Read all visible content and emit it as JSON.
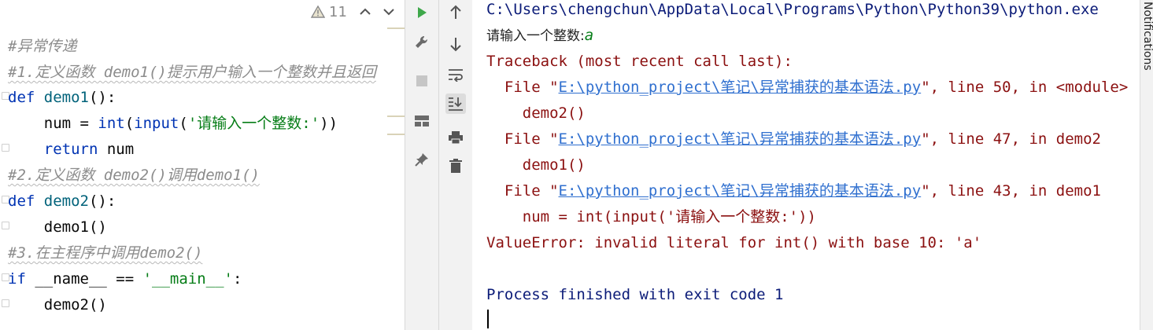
{
  "editor": {
    "warning_count": "11",
    "lines": [
      {
        "id": "c1",
        "parts": [
          {
            "t": "#异常传递",
            "c": "comment"
          }
        ]
      },
      {
        "id": "c2",
        "parts": [
          {
            "t": "#1.定义函数 demo1()提示用户输入一个整数并且返回",
            "c": "comment squig"
          }
        ]
      },
      {
        "id": "l3",
        "parts": [
          {
            "t": "def",
            "c": "kw"
          },
          {
            "t": " ",
            "c": ""
          },
          {
            "t": "demo1",
            "c": "fn"
          },
          {
            "t": "():",
            "c": ""
          }
        ]
      },
      {
        "id": "l4",
        "parts": [
          {
            "t": "    num = ",
            "c": ""
          },
          {
            "t": "int",
            "c": "kw"
          },
          {
            "t": "(",
            "c": ""
          },
          {
            "t": "input",
            "c": "kw"
          },
          {
            "t": "(",
            "c": ""
          },
          {
            "t": "'请输入一个整数:'",
            "c": "str"
          },
          {
            "t": "))",
            "c": ""
          }
        ]
      },
      {
        "id": "l5",
        "parts": [
          {
            "t": "    ",
            "c": ""
          },
          {
            "t": "return",
            "c": "kw"
          },
          {
            "t": " num",
            "c": ""
          }
        ]
      },
      {
        "id": "c6",
        "parts": [
          {
            "t": "#2.定义函数 demo2()调用demo1()",
            "c": "comment squig"
          }
        ]
      },
      {
        "id": "l7",
        "parts": [
          {
            "t": "def",
            "c": "kw"
          },
          {
            "t": " ",
            "c": ""
          },
          {
            "t": "demo2",
            "c": "fn"
          },
          {
            "t": "():",
            "c": ""
          }
        ]
      },
      {
        "id": "l8",
        "parts": [
          {
            "t": "    demo1()",
            "c": ""
          }
        ]
      },
      {
        "id": "c9",
        "parts": [
          {
            "t": "#3.在主程序中调用demo2()",
            "c": "comment squig"
          }
        ]
      },
      {
        "id": "l10",
        "parts": [
          {
            "t": "if",
            "c": "kw"
          },
          {
            "t": " __name__ == ",
            "c": ""
          },
          {
            "t": "'__main__'",
            "c": "str"
          },
          {
            "t": ":",
            "c": ""
          }
        ]
      },
      {
        "id": "l11",
        "parts": [
          {
            "t": "    demo2()",
            "c": ""
          }
        ]
      }
    ]
  },
  "run_toolbar": {
    "icons": [
      "run-icon",
      "wrench-icon",
      "stop-icon",
      "layout-icon",
      "pin-icon"
    ]
  },
  "console_toolbar": {
    "icons": [
      "up-arrow-icon",
      "down-arrow-icon",
      "soft-wrap-icon",
      "scroll-to-end-icon",
      "print-icon",
      "trash-icon"
    ]
  },
  "console": {
    "lines": [
      {
        "parts": [
          {
            "t": "C:\\Users\\chengchun\\AppData\\Local\\Programs\\Python\\Python39\\python.exe",
            "c": "navy"
          }
        ]
      },
      {
        "parts": [
          {
            "t": "请输入一个整数:",
            "c": "dark cjk"
          },
          {
            "t": "a",
            "c": "green-i"
          }
        ]
      },
      {
        "parts": [
          {
            "t": "Traceback (most recent call last):",
            "c": "red"
          }
        ]
      },
      {
        "parts": [
          {
            "t": "  File \"",
            "c": "red"
          },
          {
            "t": "E:\\python_project\\笔记\\异常捕获的基本语法.py",
            "c": "link"
          },
          {
            "t": "\", line 50, in <module>",
            "c": "red"
          }
        ]
      },
      {
        "parts": [
          {
            "t": "    demo2()",
            "c": "red"
          }
        ]
      },
      {
        "parts": [
          {
            "t": "  File \"",
            "c": "red"
          },
          {
            "t": "E:\\python_project\\笔记\\异常捕获的基本语法.py",
            "c": "link"
          },
          {
            "t": "\", line 47, in demo2",
            "c": "red"
          }
        ]
      },
      {
        "parts": [
          {
            "t": "    demo1()",
            "c": "red"
          }
        ]
      },
      {
        "parts": [
          {
            "t": "  File \"",
            "c": "red"
          },
          {
            "t": "E:\\python_project\\笔记\\异常捕获的基本语法.py",
            "c": "link"
          },
          {
            "t": "\", line 43, in demo1",
            "c": "red"
          }
        ]
      },
      {
        "parts": [
          {
            "t": "    num = int(input('请输入一个整数:'))",
            "c": "red"
          }
        ]
      },
      {
        "parts": [
          {
            "t": "ValueError: invalid literal for int() with base 10: 'a'",
            "c": "red"
          }
        ]
      },
      {
        "parts": [
          {
            "t": "",
            "c": ""
          }
        ]
      },
      {
        "parts": [
          {
            "t": "Process finished with exit code 1",
            "c": "navy"
          }
        ]
      }
    ]
  },
  "right_panel": {
    "label": "Notifications"
  }
}
